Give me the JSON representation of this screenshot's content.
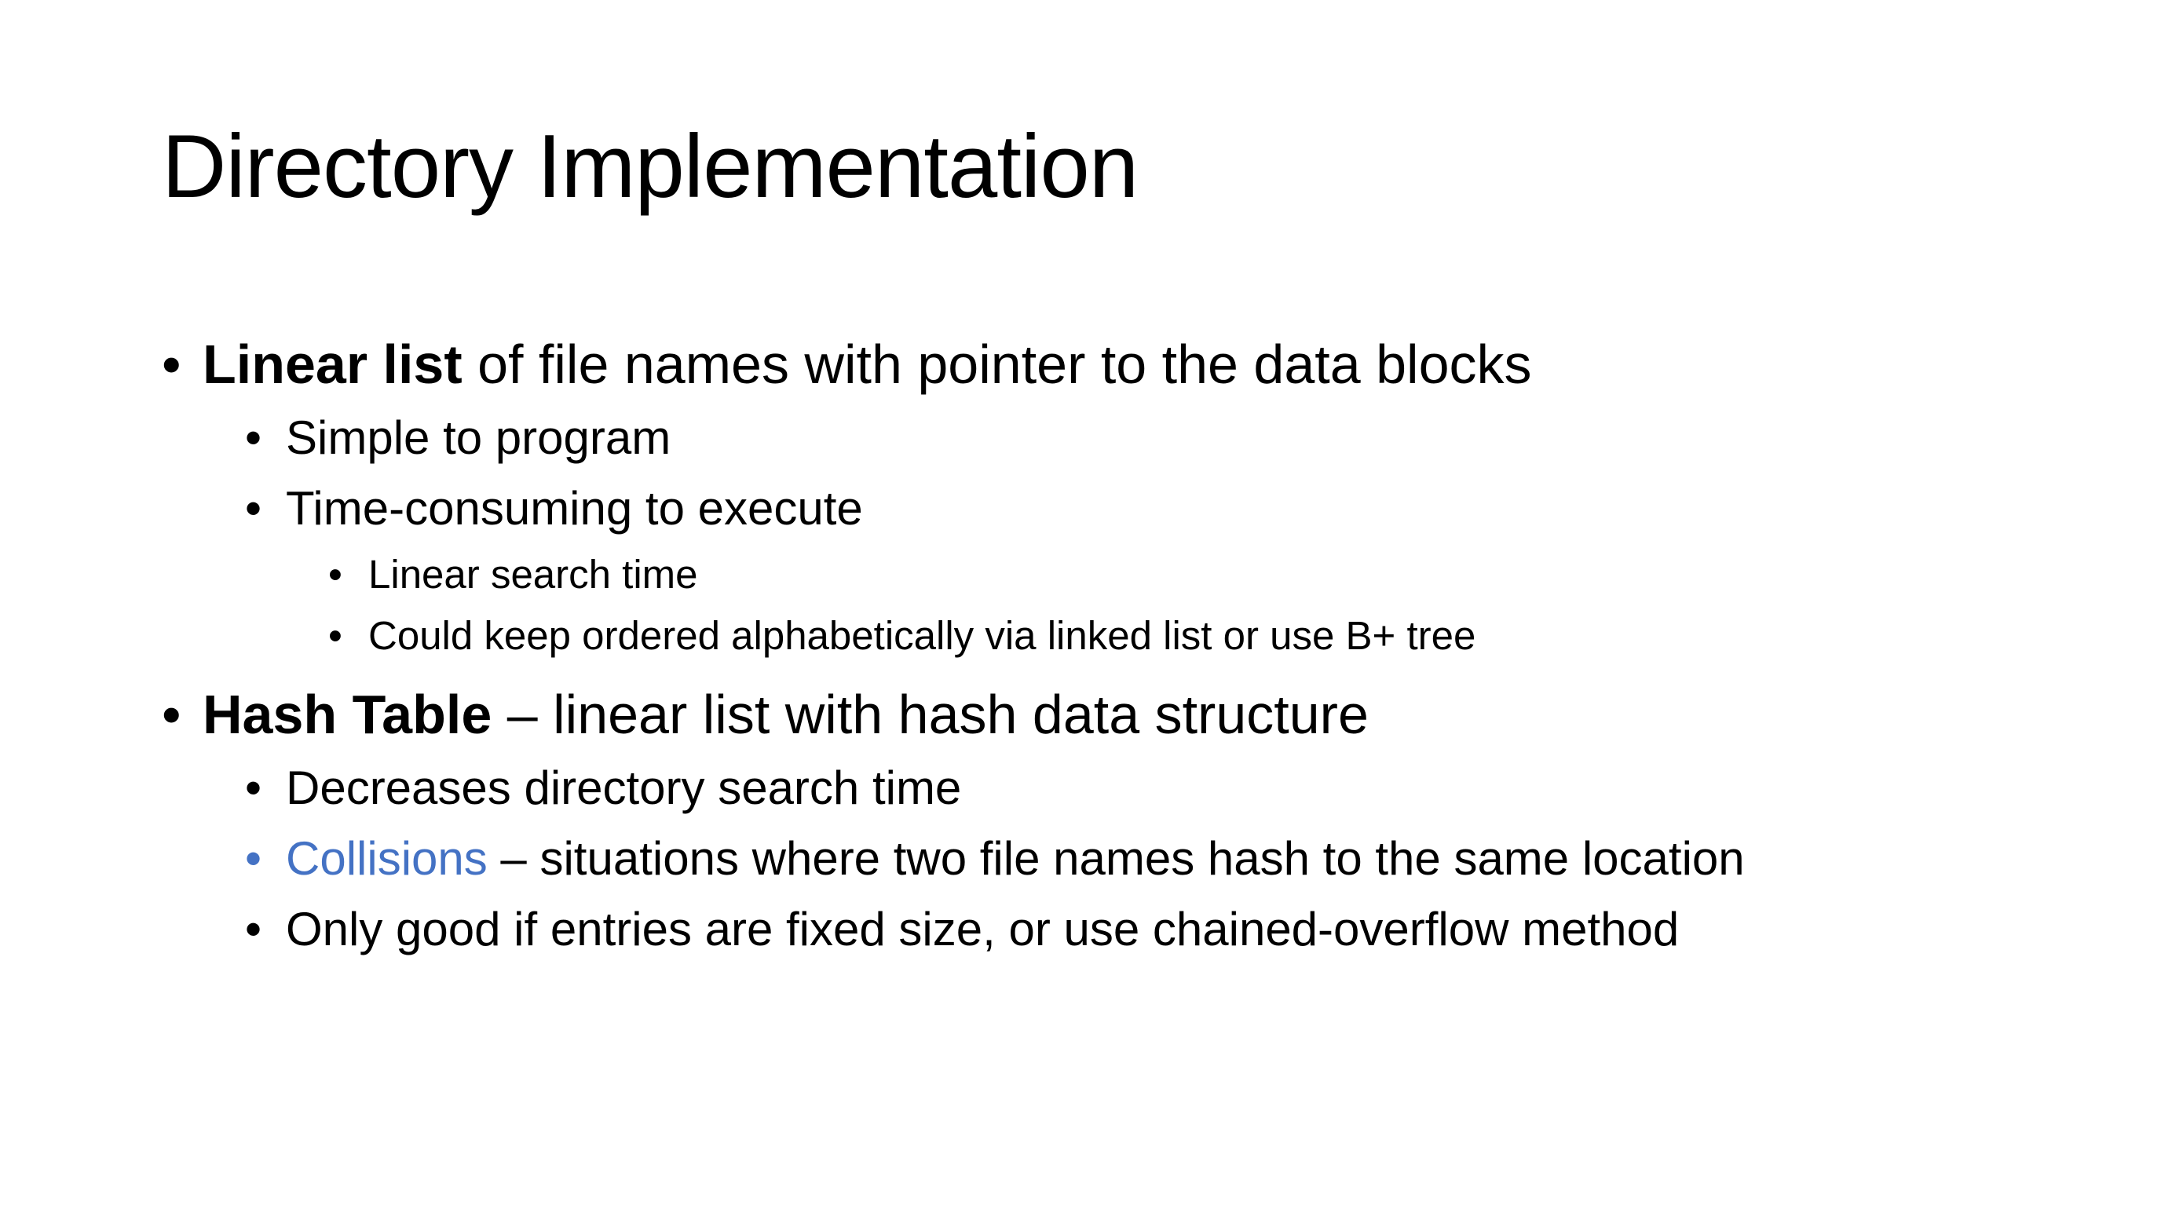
{
  "slide": {
    "title": "Directory Implementation",
    "bullet_glyph": "•",
    "accent_color": "#4472c4",
    "items": [
      {
        "bold": "Linear list",
        "text": " of file names with pointer to the data blocks",
        "children": [
          {
            "text": "Simple to program"
          },
          {
            "text": "Time-consuming to execute",
            "children": [
              {
                "text": "Linear search time"
              },
              {
                "text": "Could keep ordered alphabetically via linked list or use B+ tree"
              }
            ]
          }
        ]
      },
      {
        "bold": "Hash Table",
        "text": " – linear list with hash data structure",
        "children": [
          {
            "text": "Decreases directory search time"
          },
          {
            "highlight": "Collisions",
            "text": " – situations where two file names hash to the same location"
          },
          {
            "text": "Only good if entries are fixed size, or use chained-overflow method"
          }
        ]
      }
    ]
  }
}
